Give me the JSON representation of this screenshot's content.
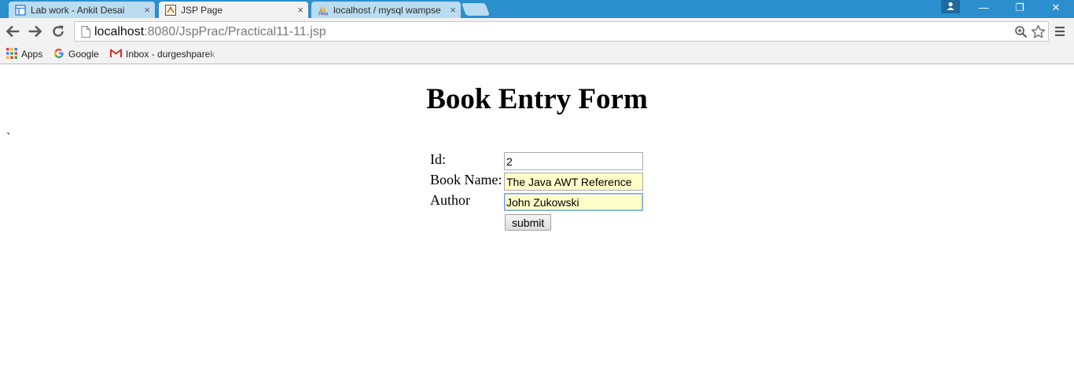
{
  "browser": {
    "tabs": [
      {
        "label": "Lab work - Ankit Desai",
        "active": false
      },
      {
        "label": "JSP Page",
        "active": true
      },
      {
        "label": "localhost / mysql wampse",
        "active": false
      }
    ],
    "tab_close_glyph": "×",
    "window_controls": {
      "minimize": "—",
      "restore": "❐",
      "close": "✕"
    },
    "address": {
      "host": "localhost",
      "path": ":8080/JspPrac/Practical11-11.jsp"
    },
    "bookmarks": [
      {
        "label": "Apps",
        "icon": "apps-grid-icon"
      },
      {
        "label": "Google",
        "icon": "google-icon"
      },
      {
        "label": "Inbox - durgeshparek",
        "icon": "gmail-icon"
      }
    ],
    "colors": {
      "titlebar": "#2b8fcd",
      "inactive_tab": "#b9dcf1",
      "toolbar": "#f2f2f2"
    }
  },
  "page": {
    "title": "Book Entry Form",
    "stray_mark": "`",
    "form": {
      "id_label": "Id:",
      "id_value": "2",
      "name_label": "Book Name:",
      "name_value": "The Java AWT Reference",
      "author_label": "Author",
      "author_value": "John Zukowski",
      "submit_label": "submit"
    },
    "colors": {
      "autofill_bg": "#fffec8",
      "focus_border": "#7aa7e0"
    }
  }
}
